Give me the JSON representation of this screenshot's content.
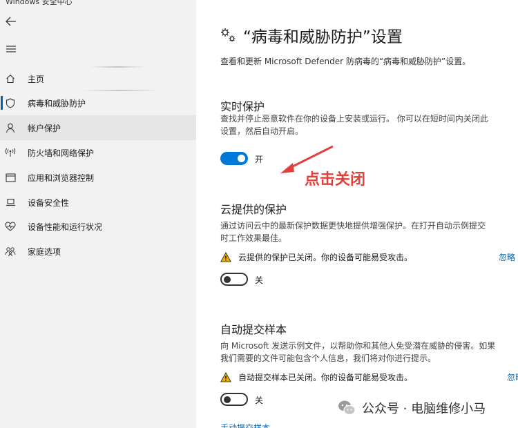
{
  "window": {
    "title": "Windows 安全中心"
  },
  "sidebar": {
    "items": [
      {
        "label": "主页",
        "icon": "home-icon"
      },
      {
        "label": "病毒和威胁防护",
        "icon": "shield-icon",
        "selected": true
      },
      {
        "label": "帐户保护",
        "icon": "person-icon"
      },
      {
        "label": "防火墙和网络保护",
        "icon": "antenna-icon"
      },
      {
        "label": "应用和浏览器控制",
        "icon": "app-window-icon"
      },
      {
        "label": "设备安全性",
        "icon": "laptop-icon"
      },
      {
        "label": "设备性能和运行状况",
        "icon": "heart-pulse-icon"
      },
      {
        "label": "家庭选项",
        "icon": "family-icon"
      }
    ]
  },
  "main": {
    "title": "“病毒和威胁防护”设置",
    "subtitle": "查看和更新 Microsoft Defender 防病毒的“病毒和威胁防护”设置。",
    "realtime": {
      "heading": "实时保护",
      "desc_line1": "查找并停止恶意软件在你的设备上安装或运行。 你可以在短时间内关闭此",
      "desc_line2": "设置，然后自动开启。",
      "toggle_label": "开",
      "toggle_on": true
    },
    "cloud": {
      "heading": "云提供的保护",
      "desc_line1": "通过访问云中的最新保护数据更快地提供增强保护。在打开自动示例提交",
      "desc_line2": "时工作效果最佳。",
      "warning": "云提供的保护已关闭。你的设备可能易受攻击。",
      "dismiss": "忽略",
      "toggle_label": "关",
      "toggle_on": false
    },
    "sample": {
      "heading": "自动提交样本",
      "desc_line1": "向 Microsoft 发送示例文件，以帮助你和其他人免受潜在威胁的侵害。如果",
      "desc_line2": "我们需要的文件可能包含个人信息，我们将对你进行提示。",
      "warning": "自动提交样本已关闭。你的设备可能易受攻击。",
      "dismiss": "忽略",
      "toggle_label": "关",
      "toggle_on": false,
      "manual_link": "手动提交样本"
    }
  },
  "annotation": {
    "text": "点击关闭",
    "color": "#e2403a"
  },
  "watermark": {
    "text": "公众号 · 电脑维修小马"
  },
  "colors": {
    "accent": "#0078d7",
    "link": "#0067b8",
    "warning": "#f2b100",
    "sidebar_bg": "#f2f2f2"
  }
}
